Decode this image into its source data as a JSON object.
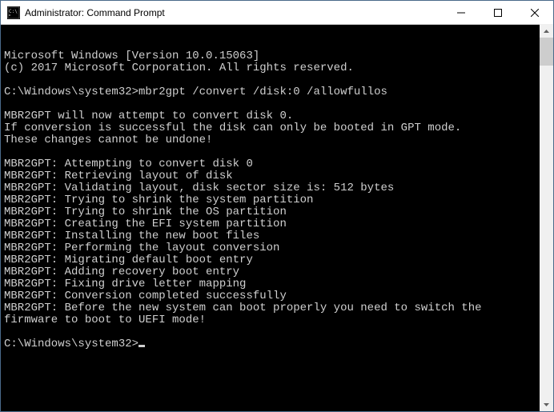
{
  "titlebar": {
    "title": "Administrator: Command Prompt"
  },
  "terminal": {
    "lines": [
      "Microsoft Windows [Version 10.0.15063]",
      "(c) 2017 Microsoft Corporation. All rights reserved.",
      "",
      "C:\\Windows\\system32>mbr2gpt /convert /disk:0 /allowfullos",
      "",
      "MBR2GPT will now attempt to convert disk 0.",
      "If conversion is successful the disk can only be booted in GPT mode.",
      "These changes cannot be undone!",
      "",
      "MBR2GPT: Attempting to convert disk 0",
      "MBR2GPT: Retrieving layout of disk",
      "MBR2GPT: Validating layout, disk sector size is: 512 bytes",
      "MBR2GPT: Trying to shrink the system partition",
      "MBR2GPT: Trying to shrink the OS partition",
      "MBR2GPT: Creating the EFI system partition",
      "MBR2GPT: Installing the new boot files",
      "MBR2GPT: Performing the layout conversion",
      "MBR2GPT: Migrating default boot entry",
      "MBR2GPT: Adding recovery boot entry",
      "MBR2GPT: Fixing drive letter mapping",
      "MBR2GPT: Conversion completed successfully",
      "MBR2GPT: Before the new system can boot properly you need to switch the firmware to boot to UEFI mode!",
      ""
    ],
    "prompt": "C:\\Windows\\system32>"
  }
}
